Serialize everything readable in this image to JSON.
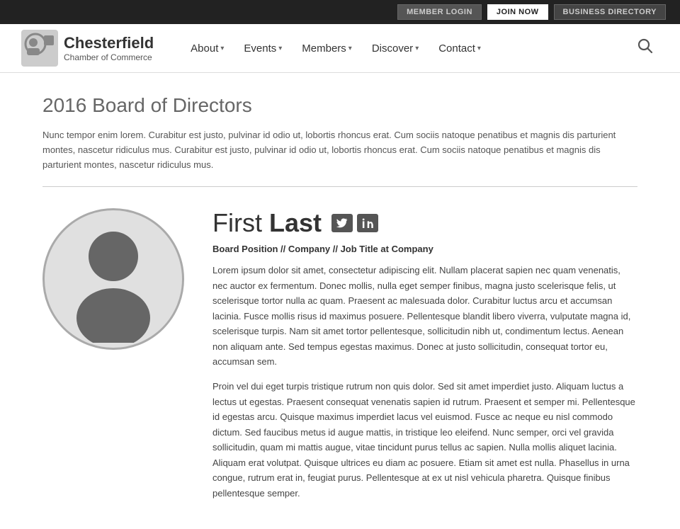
{
  "topbar": {
    "member_login": "MEMBER LOGIN",
    "join_now": "JOIN NOW",
    "business_directory": "BUSINESS DIRECTORY"
  },
  "logo": {
    "name": "Chesterfield",
    "sub": "Chamber of Commerce"
  },
  "nav": {
    "items": [
      {
        "label": "About"
      },
      {
        "label": "Events"
      },
      {
        "label": "Members"
      },
      {
        "label": "Discover"
      },
      {
        "label": "Contact"
      }
    ]
  },
  "page": {
    "title": "2016 Board of Directors",
    "intro": "Nunc tempor enim lorem. Curabitur est justo, pulvinar id odio ut, lobortis rhoncus erat. Cum sociis natoque penatibus et magnis dis parturient montes, nascetur ridiculus mus. Curabitur est justo, pulvinar id odio ut, lobortis rhoncus erat. Cum sociis natoque penatibus et magnis dis parturient montes, nascetur ridiculus mus."
  },
  "profile": {
    "first_name": "First",
    "last_name": "Last",
    "position_line": "Board Position // Company // Job Title at Company",
    "bio_1": "Lorem ipsum dolor sit amet, consectetur adipiscing elit. Nullam placerat sapien nec quam venenatis, nec auctor ex fermentum. Donec mollis, nulla eget semper finibus, magna justo scelerisque felis, ut scelerisque tortor nulla ac quam. Praesent ac malesuada dolor. Curabitur luctus arcu et accumsan lacinia. Fusce mollis risus id maximus posuere. Pellentesque blandit libero viverra, vulputate magna id, scelerisque turpis. Nam sit amet tortor pellentesque, sollicitudin nibh ut, condimentum lectus. Aenean non aliquam ante. Sed tempus egestas maximus. Donec at justo sollicitudin, consequat tortor eu, accumsan sem.",
    "bio_2": "Proin vel dui eget turpis tristique rutrum non quis dolor. Sed sit amet imperdiet justo. Aliquam luctus a lectus ut egestas. Praesent consequat venenatis sapien id rutrum. Praesent et semper mi. Pellentesque id egestas arcu. Quisque maximus imperdiet lacus vel euismod. Fusce ac neque eu nisl commodo dictum. Sed faucibus metus id augue mattis, in tristique leo eleifend. Nunc semper, orci vel gravida sollicitudin, quam mi mattis augue, vitae tincidunt purus tellus ac sapien. Nulla mollis aliquet lacinia. Aliquam erat volutpat. Quisque ultrices eu diam ac posuere. Etiam sit amet est nulla. Phasellus in urna congue, rutrum erat in, feugiat purus. Pellentesque at ex ut nisl vehicula pharetra. Quisque finibus pellentesque semper.",
    "twitter_label": "t",
    "linkedin_label": "in"
  }
}
